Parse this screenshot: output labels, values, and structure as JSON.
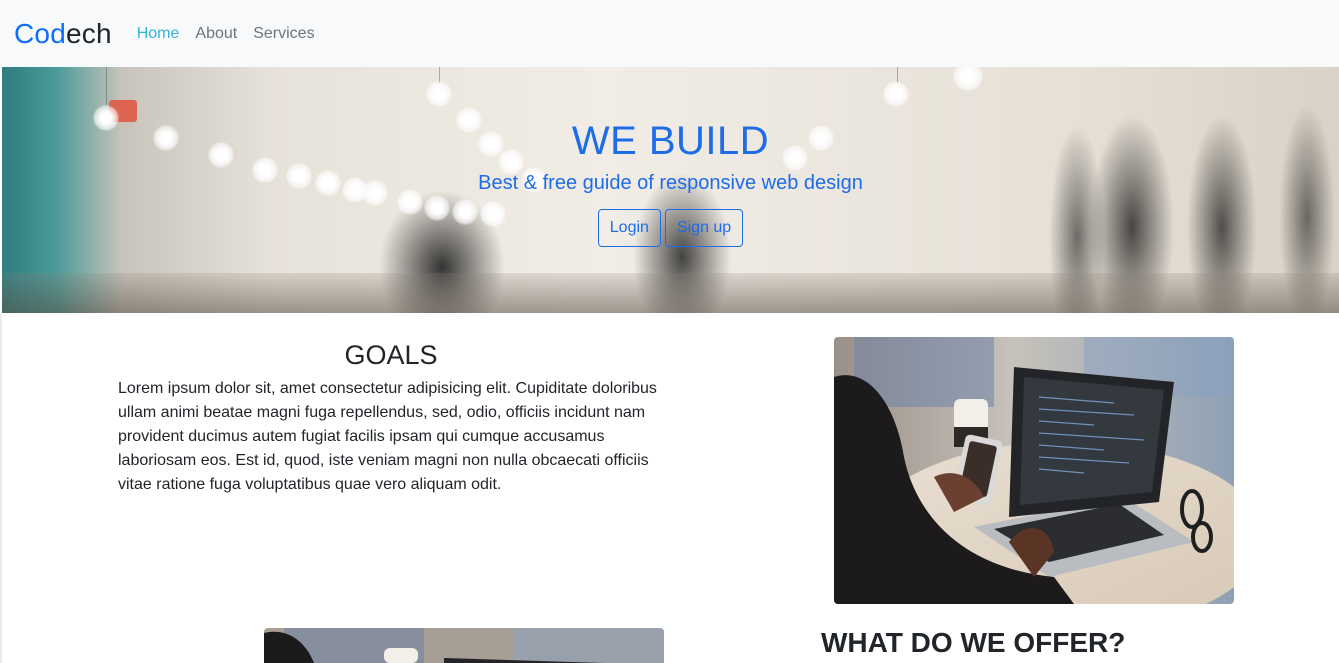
{
  "navbar": {
    "brand_part1": "Cod",
    "brand_part2": "ech",
    "links": [
      {
        "label": "Home",
        "active": true
      },
      {
        "label": "About",
        "active": false
      },
      {
        "label": "Services",
        "active": false
      }
    ]
  },
  "hero": {
    "title": "WE BUILD",
    "subtitle": "Best & free guide of responsive web design",
    "login_label": "Login",
    "signup_label": "Sign up"
  },
  "goals": {
    "title": "GOALS",
    "text": "Lorem ipsum dolor sit, amet consectetur adipisicing elit. Cupiditate doloribus ullam animi beatae magni fuga repellendus, sed, odio, officiis incidunt nam provident ducimus autem fugiat facilis ipsam qui cumque accusamus laboriosam eos. Est id, quod, iste veniam magni non nulla obcaecati officiis vitae ratione fuga voluptatibus quae vero aliquam odit."
  },
  "offer": {
    "title": "WHAT DO WE OFFER?"
  },
  "colors": {
    "brand_blue": "#0d6efd",
    "hero_text": "#1d6ce8",
    "active_link": "#2fb7d8",
    "navbar_bg": "#f8f9fa"
  }
}
